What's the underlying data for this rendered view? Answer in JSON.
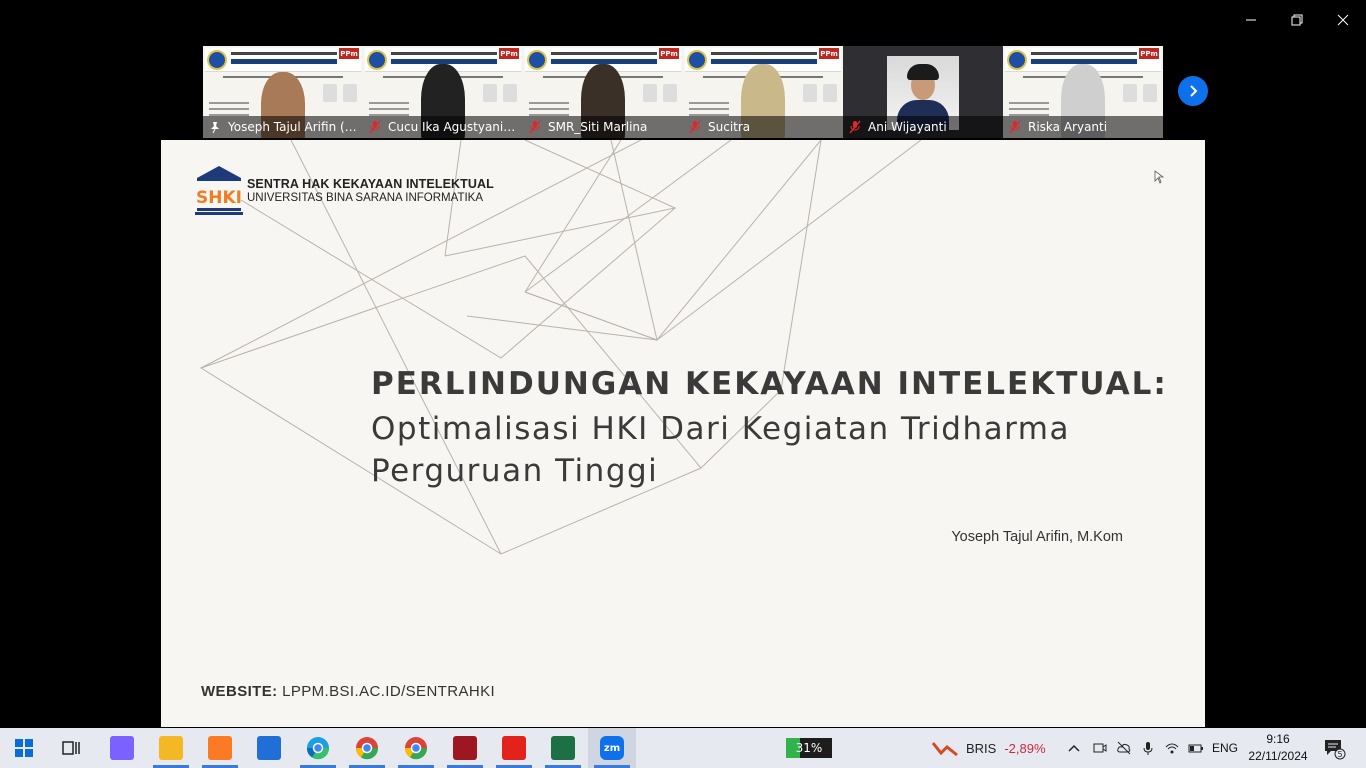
{
  "participants": [
    {
      "name": "Yoseph Tajul Arifin (U...",
      "active": true,
      "muted": false,
      "kind": "slide-person",
      "person_color": "#a87a58"
    },
    {
      "name": "Cucu Ika Agustyaning...",
      "active": false,
      "muted": true,
      "kind": "slide-person",
      "person_color": "#222222"
    },
    {
      "name": "SMR_Siti Marlina",
      "active": false,
      "muted": true,
      "kind": "slide-person",
      "person_color": "#3a3028"
    },
    {
      "name": "Sucitra",
      "active": false,
      "muted": true,
      "kind": "slide-person",
      "person_color": "#c9b98a"
    },
    {
      "name": "Ani Wijayanti",
      "active": false,
      "muted": true,
      "kind": "photo",
      "person_color": "#1f2e56"
    },
    {
      "name": "Riska Aryanti",
      "active": false,
      "muted": true,
      "kind": "slide-person",
      "person_color": "#cfcfcf"
    }
  ],
  "slide": {
    "brand_line1": "SENTRA HAK KEKAYAAN INTELEKTUAL",
    "brand_line2": "UNIVERSITAS BINA SARANA INFORMATIKA",
    "logo_text": "SHKI",
    "title": "PERLINDUNGAN KEKAYAAN INTELEKTUAL:",
    "subtitle": "Optimalisasi HKI Dari Kegiatan Tridharma Perguruan Tinggi",
    "author": "Yoseph Tajul Arifin, M.Kom",
    "website_label": "WEBSITE:",
    "website_url": "LPPM.BSI.AC.ID/SENTRAHKI"
  },
  "taskbar": {
    "apps": [
      {
        "name": "start",
        "color": "#0a6cd6"
      },
      {
        "name": "task-view",
        "color": "#222222"
      },
      {
        "name": "copilot",
        "color": "#7b61ff"
      },
      {
        "name": "file-explorer",
        "color": "#f3b823"
      },
      {
        "name": "xampp",
        "color": "#fb7a24"
      },
      {
        "name": "mail",
        "color": "#1f6fd6"
      },
      {
        "name": "edge",
        "color": "#1aa0e0"
      },
      {
        "name": "chrome-profile",
        "color": "#db4437"
      },
      {
        "name": "chrome",
        "color": "#34a853"
      },
      {
        "name": "mendeley",
        "color": "#9d1620"
      },
      {
        "name": "acrobat",
        "color": "#e3231b"
      },
      {
        "name": "excel",
        "color": "#1d7044"
      },
      {
        "name": "zoom",
        "color": "#0e71eb"
      }
    ],
    "battery_widget": "31%",
    "stock_symbol": "BRIS",
    "stock_change": "-2,89%",
    "language": "ENG",
    "time": "9:16",
    "date": "22/11/2024",
    "notification_count": "5"
  }
}
